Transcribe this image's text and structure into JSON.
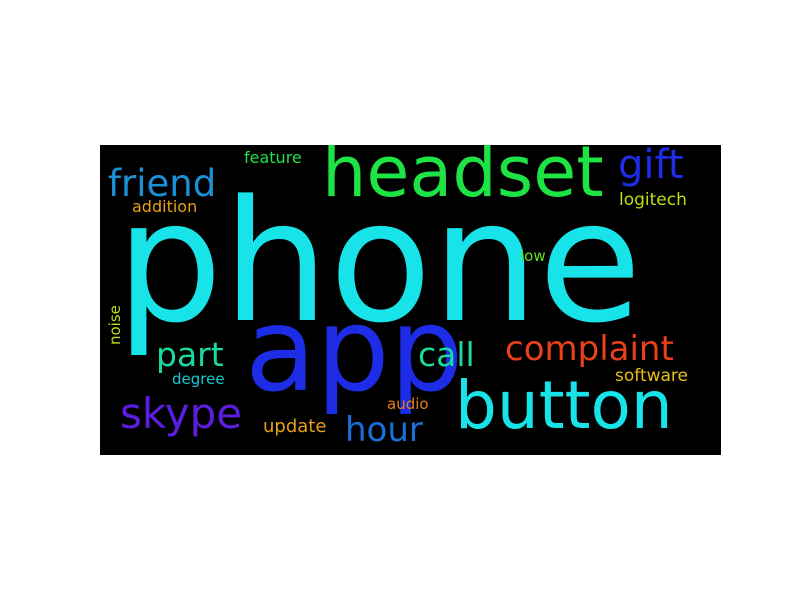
{
  "wordcloud": {
    "words": [
      {
        "text": "phone",
        "color": "#17e3e8"
      },
      {
        "text": "headset",
        "color": "#1ee345"
      },
      {
        "text": "app",
        "color": "#1d2ce6"
      },
      {
        "text": "button",
        "color": "#17e3e8"
      },
      {
        "text": "gift",
        "color": "#1d2ce6"
      },
      {
        "text": "friend",
        "color": "#1a90d8"
      },
      {
        "text": "complaint",
        "color": "#e8401a"
      },
      {
        "text": "skype",
        "color": "#5b1ee0"
      },
      {
        "text": "part",
        "color": "#19d8a0"
      },
      {
        "text": "call",
        "color": "#19d8a0"
      },
      {
        "text": "hour",
        "color": "#1a6ed8"
      },
      {
        "text": "feature",
        "color": "#1ee345"
      },
      {
        "text": "addition",
        "color": "#e8a016"
      },
      {
        "text": "logitech",
        "color": "#b8e016"
      },
      {
        "text": "low",
        "color": "#5de01e"
      },
      {
        "text": "noise",
        "color": "#b8e016"
      },
      {
        "text": "degree",
        "color": "#19c8d0"
      },
      {
        "text": "software",
        "color": "#e8c016"
      },
      {
        "text": "audio",
        "color": "#e88016"
      },
      {
        "text": "update",
        "color": "#e8a016"
      }
    ]
  }
}
